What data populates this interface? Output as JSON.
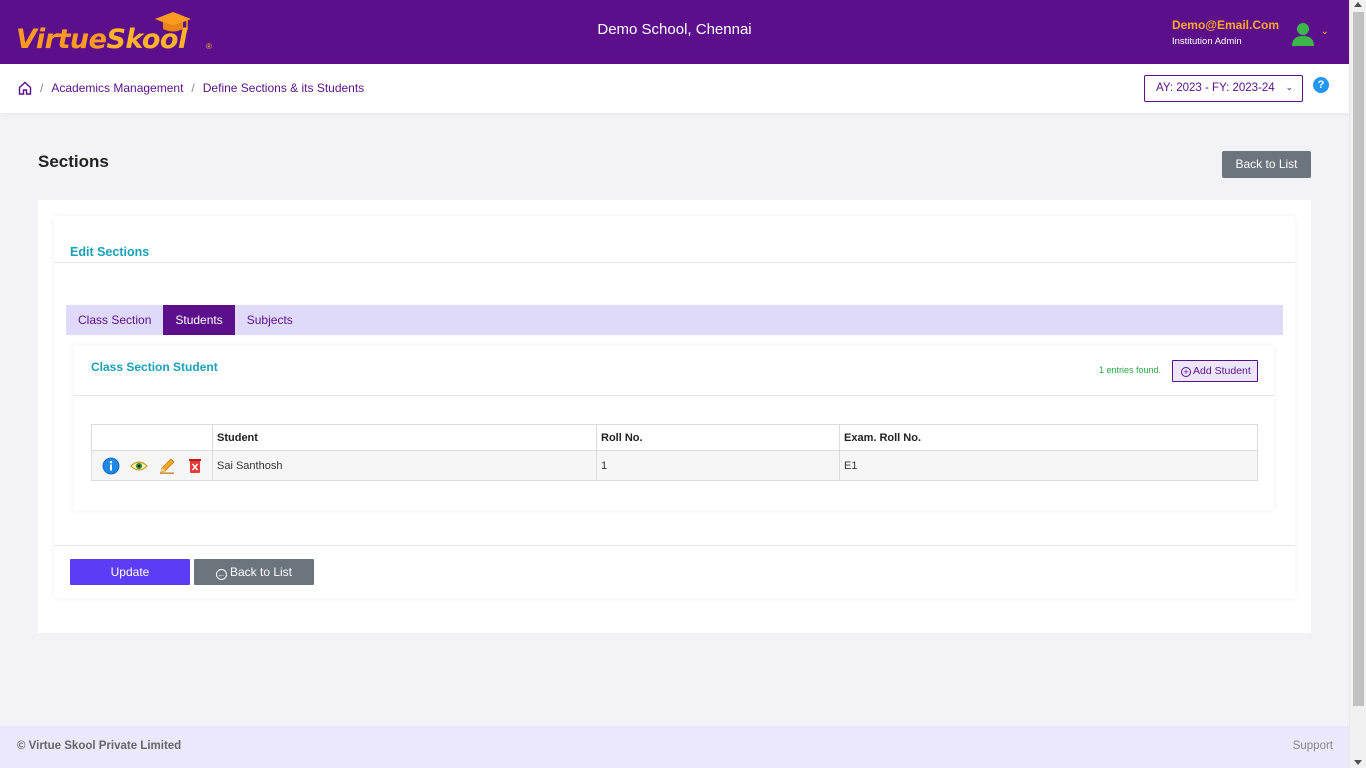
{
  "header": {
    "logo_text_a": "Virtue",
    "logo_text_b": "Skool",
    "logo_reg": "®",
    "school_name": "Demo School, Chennai",
    "user_email": "Demo@Email.Com",
    "user_role": "Institution Admin"
  },
  "breadcrumb": {
    "items": [
      "Academics Management",
      "Define Sections & its Students"
    ],
    "separator": "/"
  },
  "ay_select": {
    "value": "AY: 2023 - FY: 2023-24"
  },
  "help": {
    "label": "?"
  },
  "page": {
    "title": "Sections",
    "back_to_list": "Back to List"
  },
  "card": {
    "title": "Edit Sections",
    "tabs": [
      {
        "label": "Class Section",
        "active": false
      },
      {
        "label": "Students",
        "active": true
      },
      {
        "label": "Subjects",
        "active": false
      }
    ]
  },
  "student_panel": {
    "title": "Class Section Student",
    "entries_found": "1 entries found.",
    "add_button": "Add Student",
    "columns": [
      "Student",
      "Roll No.",
      "Exam. Roll No."
    ],
    "rows": [
      {
        "student": "Sai Santhosh",
        "roll_no": "1",
        "exam_roll_no": "E1"
      }
    ]
  },
  "actions": {
    "update": "Update",
    "back_to_list": "Back to List"
  },
  "footer": {
    "copyright": "© Virtue Skool Private Limited",
    "support": "Support"
  },
  "colors": {
    "brand_purple": "#5c0f8b",
    "accent_orange": "#ffa726",
    "teal_heading": "#17a2b8",
    "update_button": "#5c3cf5",
    "secondary_button": "#6c757d"
  }
}
